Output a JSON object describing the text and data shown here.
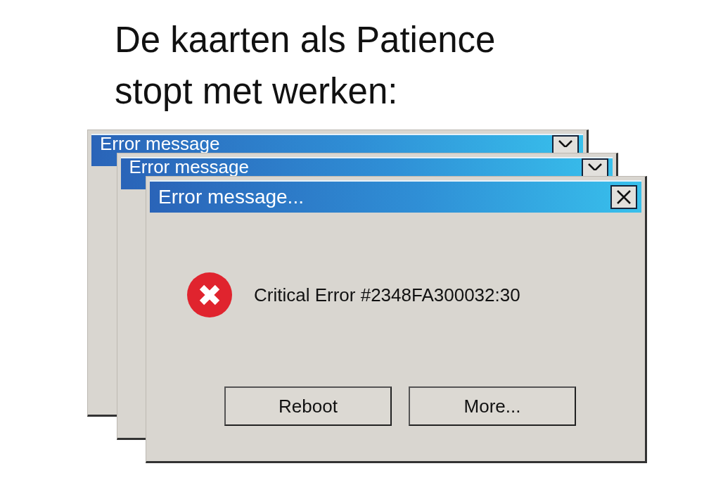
{
  "caption": [
    "De kaarten als Patience",
    "stopt met werken:"
  ],
  "windows": [
    {
      "title": "Error message"
    },
    {
      "title": "Error message"
    },
    {
      "title": "Error message...",
      "message": "Critical Error #2348FA300032:30",
      "buttons": [
        "Reboot",
        "More..."
      ]
    }
  ]
}
